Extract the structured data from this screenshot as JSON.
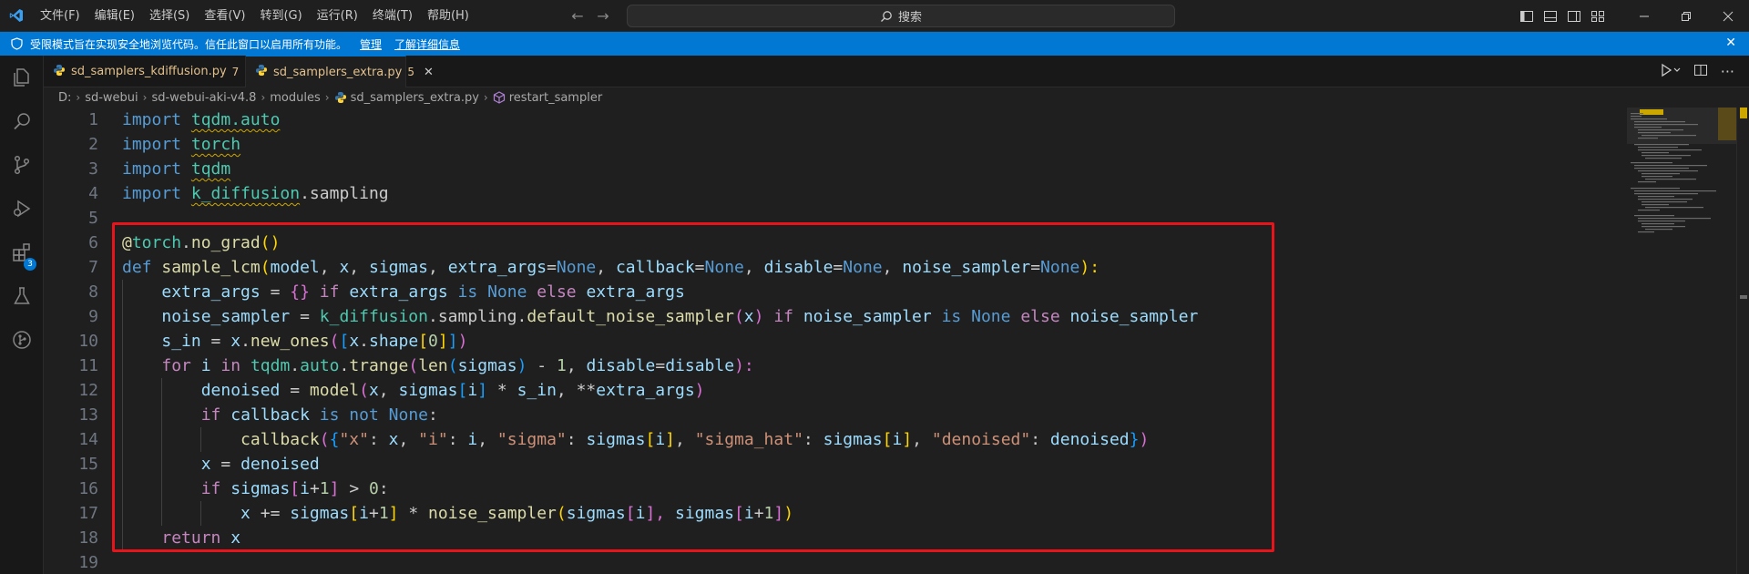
{
  "menu": [
    "文件(F)",
    "编辑(E)",
    "选择(S)",
    "查看(V)",
    "转到(G)",
    "运行(R)",
    "终端(T)",
    "帮助(H)"
  ],
  "search": {
    "label": "搜索"
  },
  "banner": {
    "message": "受限模式旨在实现安全地浏览代码。信任此窗口以启用所有功能。",
    "manage_link": "管理",
    "learn_link": "了解详细信息"
  },
  "activity": {
    "extensions_badge": "3"
  },
  "tabs": [
    {
      "name": "sd_samplers_kdiffusion.py",
      "count": "7"
    },
    {
      "name": "sd_samplers_extra.py",
      "count": "5",
      "close": "✕"
    }
  ],
  "breadcrumb": [
    "D:",
    "sd-webui",
    "sd-webui-aki-v4.8",
    "modules",
    "sd_samplers_extra.py",
    "restart_sampler"
  ],
  "line_numbers": [
    "1",
    "2",
    "3",
    "4",
    "5",
    "6",
    "7",
    "8",
    "9",
    "10",
    "11",
    "12",
    "13",
    "14",
    "15",
    "16",
    "17",
    "18",
    "19"
  ],
  "code": {
    "l1": [
      "import",
      "tqdm.auto"
    ],
    "l2": [
      "import",
      "torch"
    ],
    "l3": [
      "import",
      "tqdm"
    ],
    "l4": [
      "import",
      "k_diffusion",
      ".sampling"
    ],
    "l6": [
      "@",
      "torch",
      ".",
      "no_grad",
      "()"
    ],
    "l7": [
      "def",
      "sample_lcm",
      "(",
      "model",
      ", ",
      "x",
      ", ",
      "sigmas",
      ", ",
      "extra_args",
      "=",
      "None",
      ", ",
      "callback",
      "=",
      "None",
      ", ",
      "disable",
      "=",
      "None",
      ", ",
      "noise_sampler",
      "=",
      "None",
      "):"
    ],
    "l8": [
      "extra_args",
      " = ",
      "{}",
      "if",
      "extra_args",
      "is",
      "None",
      "else",
      "extra_args"
    ],
    "l9": [
      "noise_sampler",
      " = ",
      "k_diffusion",
      ".sampling.",
      "default_noise_sampler",
      "(",
      "x",
      ")",
      "if",
      "noise_sampler",
      "is",
      "None",
      "else",
      "noise_sampler"
    ],
    "l10": [
      "s_in",
      " = ",
      "x",
      ".",
      "new_ones",
      "(",
      "[",
      "x",
      ".",
      "shape",
      "[",
      "0",
      "]",
      "]",
      ")"
    ],
    "l11": [
      "for",
      "i",
      "in",
      "tqdm",
      ".",
      "auto",
      ".",
      "trange",
      "(",
      "len",
      "(",
      "sigmas",
      ")",
      " - ",
      "1",
      ", ",
      "disable",
      "=",
      "disable",
      "):"
    ],
    "l12": [
      "denoised",
      " = ",
      "model",
      "(",
      "x",
      ", ",
      "sigmas",
      "[",
      "i",
      "]",
      " * ",
      "s_in",
      ", **",
      "extra_args",
      ")"
    ],
    "l13": [
      "if",
      "callback",
      "is not",
      "None",
      ":"
    ],
    "l14": [
      "callback",
      "(",
      "{",
      "\"x\"",
      ": ",
      "x",
      ", ",
      "\"i\"",
      ": ",
      "i",
      ", ",
      "\"sigma\"",
      ": ",
      "sigmas",
      "[",
      "i",
      "]",
      ", ",
      "\"sigma_hat\"",
      ": ",
      "sigmas",
      "[",
      "i",
      "]",
      ", ",
      "\"denoised\"",
      ": ",
      "denoised",
      "}",
      ")"
    ],
    "l15": [
      "x",
      " = ",
      "denoised"
    ],
    "l16": [
      "if",
      "sigmas",
      "[",
      "i",
      "+",
      "1",
      "]",
      " > ",
      "0",
      ":"
    ],
    "l17": [
      "x",
      " += ",
      "sigmas",
      "[",
      "i",
      "+",
      "1",
      "]",
      " * ",
      "noise_sampler",
      "(",
      "sigmas",
      "[",
      "i",
      "], ",
      "sigmas",
      "[",
      "i",
      "+",
      "1",
      "]",
      ")"
    ],
    "l18": [
      "return",
      "x"
    ]
  }
}
